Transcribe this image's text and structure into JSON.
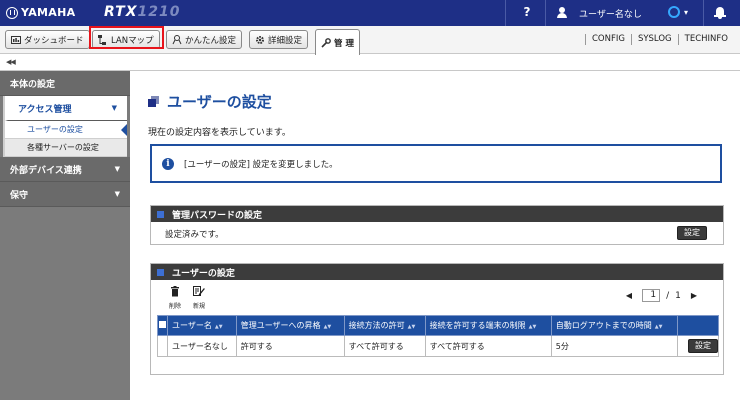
{
  "header": {
    "brand": "YAMAHA",
    "model_main": "RTX",
    "model_num": "1210",
    "help": "?",
    "user_name": "ユーザー名なし",
    "status_caret": "▾",
    "icons": [
      "yamaha-logo",
      "help-icon",
      "user-icon",
      "status-ring-icon",
      "bell-icon"
    ]
  },
  "tabs": [
    {
      "label": "ダッシュボード",
      "icon": "dashboard-icon"
    },
    {
      "label": "LANマップ",
      "icon": "lan-map-icon"
    },
    {
      "label": "かんたん設定",
      "icon": "easy-setup-icon"
    },
    {
      "label": "詳細設定",
      "icon": "gear-icon"
    },
    {
      "label": "管 理",
      "icon": "wrench-icon"
    }
  ],
  "toplinks": [
    "CONFIG",
    "SYSLOG",
    "TECHINFO"
  ],
  "collapse": "◀◀",
  "sidebar": {
    "sections": [
      {
        "label": "本体の設定"
      },
      {
        "label": "アクセス管理",
        "caret": "▼",
        "items": [
          "ユーザーの設定",
          "各種サーバーの設定"
        ]
      },
      {
        "label": "外部デバイス連携",
        "caret": "▼"
      },
      {
        "label": "保守",
        "caret": "▼"
      }
    ]
  },
  "main": {
    "title": "ユーザーの設定",
    "description": "現在の設定内容を表示しています。",
    "notice": "[ユーザーの設定] 設定を変更しました。",
    "notice_icon": "i",
    "password_section": {
      "title": "管理パスワードの設定",
      "status": "設定済みです。",
      "button": "設定"
    },
    "user_section": {
      "title": "ユーザーの設定",
      "tools": [
        {
          "label": "削除",
          "glyph": "🗑"
        },
        {
          "label": "新規",
          "glyph": "✎"
        }
      ],
      "pager": {
        "prev": "◀",
        "current": "1",
        "sep": "/",
        "total": "1",
        "next": "▶"
      },
      "columns": [
        "ユーザー名",
        "管理ユーザーへの昇格",
        "接続方法の許可",
        "接続を許可する端末の制限",
        "自動ログアウトまでの時間"
      ],
      "sort_glyph": "▲▼",
      "rows": [
        {
          "cells": [
            "ユーザー名なし",
            "許可する",
            "すべて許可する",
            "すべて許可する",
            "5分"
          ],
          "button": "設定"
        }
      ]
    }
  },
  "colors": {
    "header_bg": "#1e2f86",
    "accent": "#1e4fa0",
    "highlight": "#e8141b",
    "sidebar_bg": "#7b7b7b"
  }
}
